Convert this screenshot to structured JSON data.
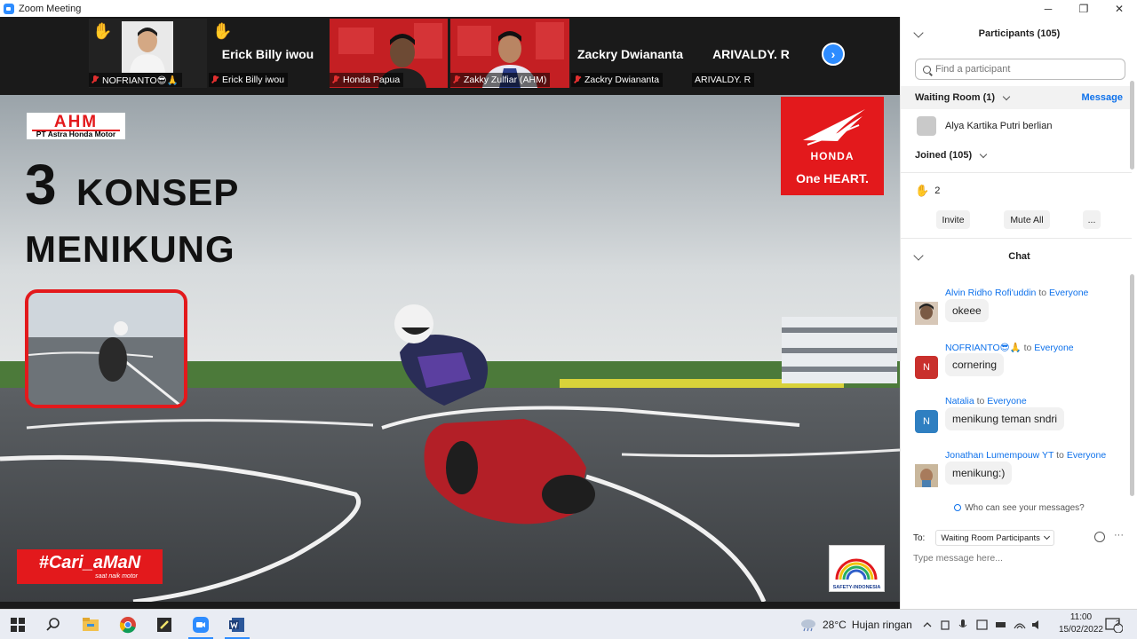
{
  "window": {
    "title": "Zoom Meeting",
    "controls": {
      "minimize": "─",
      "maximize": "❐",
      "close": "✕"
    }
  },
  "strip": {
    "tiles": [
      {
        "name": "NOFRIANTO😎🙏",
        "hand": "✋",
        "muted": true
      },
      {
        "name": "Erick Billy iwou",
        "big_name": "Erick Billy iwou",
        "hand": "✋",
        "muted": true
      },
      {
        "name": "Honda Papua",
        "muted": true
      },
      {
        "name": "Zakky Zulfiar (AHM)",
        "muted": true
      },
      {
        "name": "Zackry Dwiananta",
        "big_name": "Zackry Dwiananta",
        "muted": true
      },
      {
        "name": "ARIVALDY. R",
        "big_name": "ARIVALDY. R",
        "muted": false
      }
    ],
    "next_label": "›"
  },
  "slide": {
    "ahm_logo": "AHM",
    "ahm_sub": "PT Astra Honda Motor",
    "number": "3",
    "title_word": "KONSEP",
    "title_line2": "MENIKUNG",
    "honda_word": "HONDA",
    "oneheart": "One HEART.",
    "cari": "#Cari_aMaN",
    "cari_sub": "saat naik motor",
    "safety_text": "SAFETY-INDONESIA"
  },
  "participants": {
    "header": "Participants (105)",
    "search_placeholder": "Find a participant",
    "waiting_room_label": "Waiting Room (1)",
    "message_label": "Message",
    "waiting_person": "Alya Kartika Putri berlian",
    "joined_label": "Joined (105)",
    "raised_count": "2",
    "hand_icon": "✋",
    "invite_label": "Invite",
    "mute_all_label": "Mute All",
    "more_label": "..."
  },
  "chat": {
    "header": "Chat",
    "to_word": "to",
    "messages": [
      {
        "sender": "Alvin Ridho Rofi'uddin",
        "recipient": "Everyone",
        "text": "okeee",
        "avatar": "",
        "avatar_color": "#5a4f46"
      },
      {
        "sender": "NOFRIANTO😎🙏",
        "recipient": "Everyone",
        "text": "cornering",
        "avatar": "N",
        "avatar_color": "#c9302c"
      },
      {
        "sender": "Natalia",
        "recipient": "Everyone",
        "text": "menikung teman sndri",
        "avatar": "N",
        "avatar_color": "#2f7fc1"
      },
      {
        "sender": "Jonathan Lumempouw YT",
        "recipient": "Everyone",
        "text": "menikung:)",
        "avatar": "",
        "avatar_color": "#a08a70"
      }
    ],
    "who_can_see": "Who can see your messages?",
    "to_label": "To:",
    "to_value": "Waiting Room Participants",
    "input_placeholder": "Type message here...",
    "more_label": "···"
  },
  "taskbar": {
    "weather": "28°C",
    "weather_desc": "Hujan ringan",
    "time": "11:00",
    "date": "15/02/2022",
    "notification_count": "2"
  },
  "colors": {
    "accent": "#0e71eb",
    "zoom_blue": "#2d8cff",
    "honda_red": "#e3191c"
  }
}
